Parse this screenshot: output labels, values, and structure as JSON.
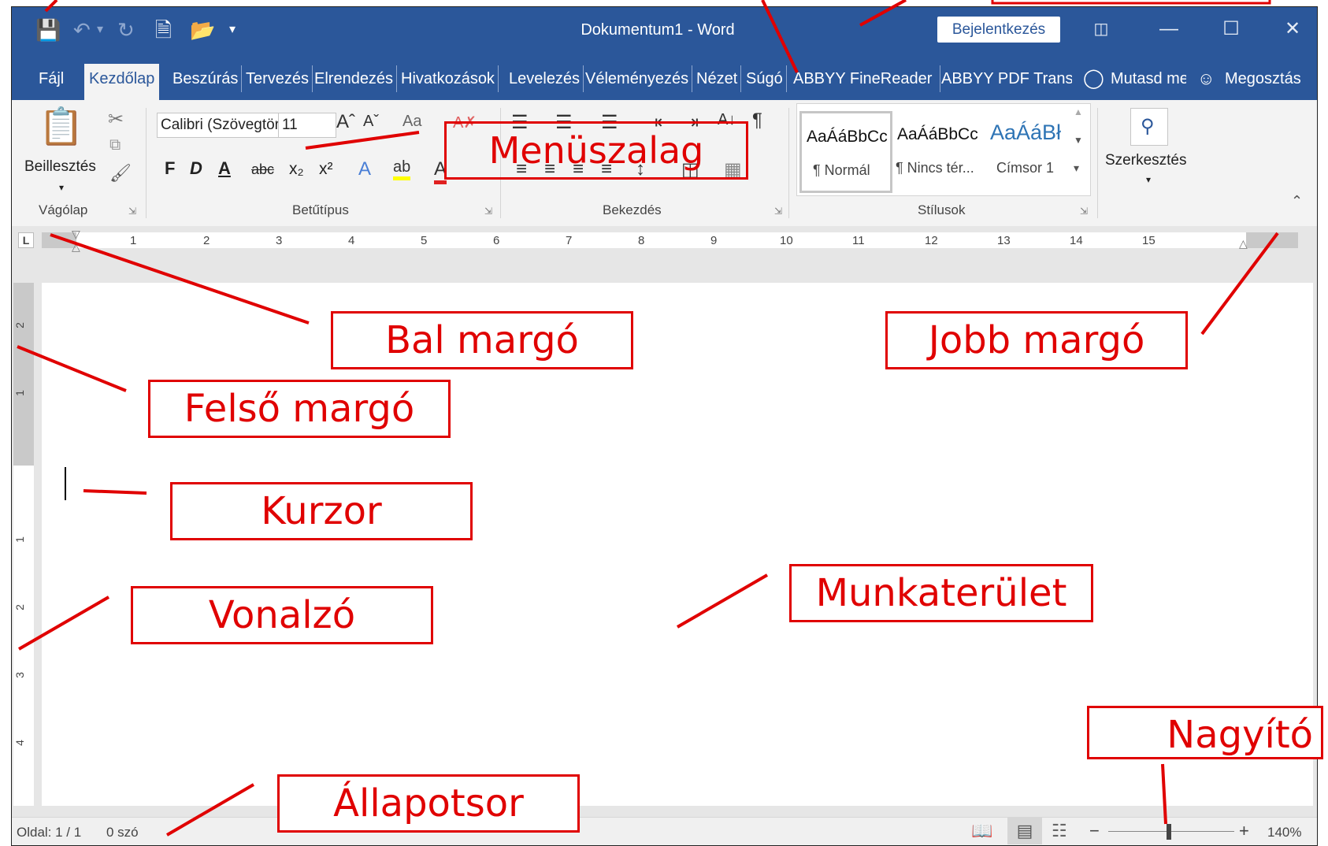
{
  "window": {
    "title": "Dokumentum1  -  Word",
    "signin": "Bejelentkezés"
  },
  "tabs": [
    "Fájl",
    "Kezdőlap",
    "Beszúrás",
    "Tervezés",
    "Elrendezés",
    "Hivatkozások",
    "Levelezés",
    "Véleményezés",
    "Nézet",
    "Súgó",
    "ABBYY FineReader",
    "ABBYY PDF Transfo",
    "Mutasd meg",
    "Megosztás"
  ],
  "ribbon": {
    "paste_label": "Beillesztés",
    "font_name": "Calibri (Szövegtörzs)",
    "font_size": "11",
    "bold": "F",
    "italic": "D",
    "underline": "A",
    "strike": "abc",
    "subscript": "x₂",
    "superscript": "x²",
    "styles": [
      {
        "sample": "AaÁáBbCc",
        "name": "¶ Normál"
      },
      {
        "sample": "AaÁáBbCc",
        "name": "¶ Nincs tér..."
      },
      {
        "sample": "AaÁáBł",
        "name": "Címsor 1"
      }
    ],
    "edit_label": "Szerkesztés",
    "groups": [
      "Vágólap",
      "Betűtípus",
      "Bekezdés",
      "Stílusok"
    ]
  },
  "ruler": {
    "h_ticks": [
      "1",
      "2",
      "3",
      "4",
      "5",
      "6",
      "7",
      "8",
      "9",
      "10",
      "11",
      "12",
      "13",
      "14",
      "15"
    ],
    "v_ticks": [
      "2",
      "1",
      "1",
      "2",
      "3",
      "4"
    ]
  },
  "status": {
    "page": "Oldal: 1 / 1",
    "words": "0 szó",
    "zoom": "140%"
  },
  "annotations": {
    "ribbon": "Menüszalag",
    "left_margin": "Bal margó",
    "right_margin": "Jobb margó",
    "top_margin": "Felső margó",
    "cursor": "Kurzor",
    "workspace": "Munkaterület",
    "ruler": "Vonalzó",
    "zoom": "Nagyító",
    "statusbar": "Állapotsor"
  }
}
